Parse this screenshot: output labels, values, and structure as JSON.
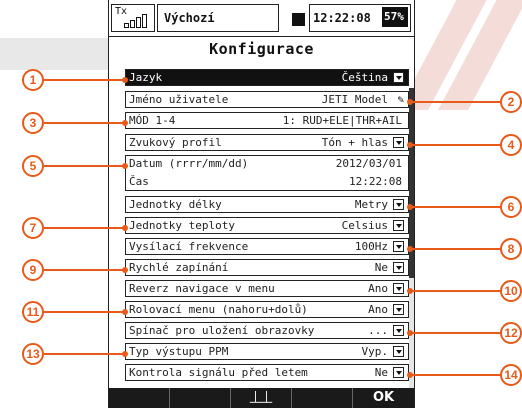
{
  "status": {
    "tx_label": "Tx",
    "model_name": "Výchozí",
    "time": "12:22:08",
    "battery": "57%"
  },
  "title": "Konfigurace",
  "rows": [
    {
      "label": "Jazyk",
      "value": "Čeština",
      "control": "dropdown",
      "selected": true
    },
    {
      "label": "Jméno uživatele",
      "value": "JETI Model",
      "control": "edit"
    },
    {
      "label": "MÓD 1-4",
      "value": "1: RUD+ELE|THR+AIL",
      "control": "none"
    },
    {
      "label": "Zvukový profil",
      "value": "Tón + hlas",
      "control": "dropdown"
    },
    {
      "label": "Datum (rrrr/mm/dd)",
      "value": "2012/03/01",
      "label2": "Čas",
      "value2": "12:22:08",
      "control": "double"
    },
    {
      "label": "Jednotky délky",
      "value": "Metry",
      "control": "dropdown"
    },
    {
      "label": "Jednotky teploty",
      "value": "Celsius",
      "control": "dropdown"
    },
    {
      "label": "Vysílací frekvence",
      "value": "100Hz",
      "control": "dropdown"
    },
    {
      "label": "Rychlé zapínání",
      "value": "Ne",
      "control": "dropdown"
    },
    {
      "label": "Reverz navigace v menu",
      "value": "Ano",
      "control": "dropdown"
    },
    {
      "label": "Rolovací menu (nahoru+dolů)",
      "value": "Ano",
      "control": "dropdown"
    },
    {
      "label": "Spínač pro uložení obrazovky",
      "value": "...",
      "control": "dropdown"
    },
    {
      "label": "Typ výstupu PPM",
      "value": "Vyp.",
      "control": "dropdown"
    },
    {
      "label": "Kontrola signálu před letem",
      "value": "Ne",
      "control": "dropdown"
    }
  ],
  "callouts": [
    "1",
    "2",
    "3",
    "4",
    "5",
    "6",
    "7",
    "8",
    "9",
    "10",
    "11",
    "12",
    "13",
    "14"
  ],
  "footer": {
    "btn1": "",
    "btn2": "",
    "btn3": "⏊⏊",
    "btn4": "",
    "ok": "OK"
  },
  "colors": {
    "accent": "#e85a1a",
    "watermark": "#f4dcd8"
  }
}
